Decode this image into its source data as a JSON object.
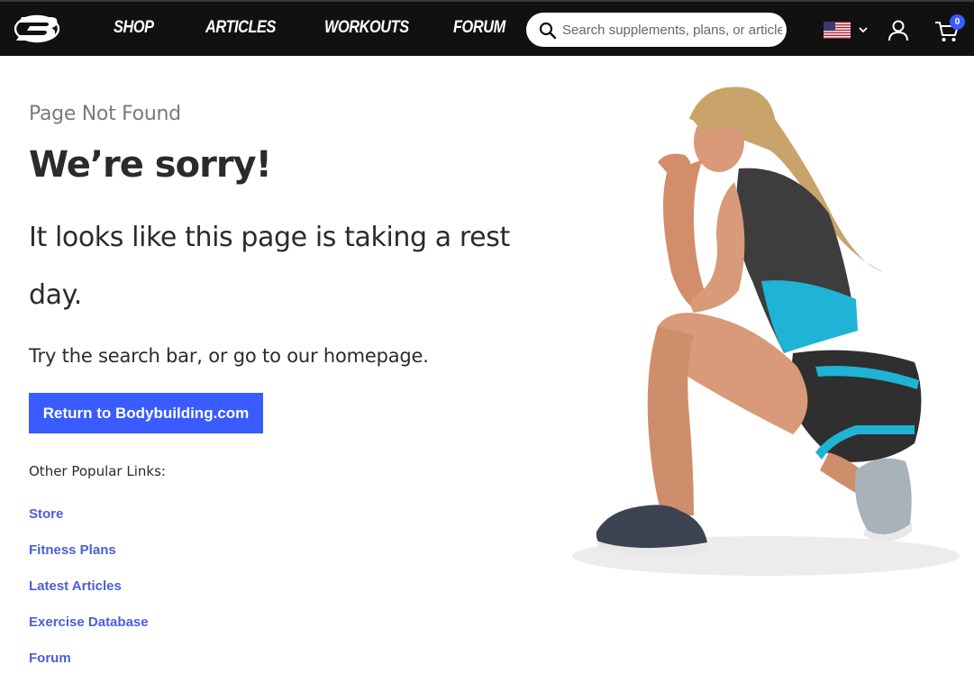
{
  "header": {
    "logo_name": "bodybuilding-b-logo",
    "nav": [
      {
        "label": "SHOP"
      },
      {
        "label": "ARTICLES"
      },
      {
        "label": "WORKOUTS"
      },
      {
        "label": "FORUM"
      }
    ],
    "search": {
      "placeholder": "Search supplements, plans, or articles",
      "value": ""
    },
    "cart_count": "0",
    "colors": {
      "background": "#111111",
      "accent": "#3a5bff"
    }
  },
  "main": {
    "eyebrow": "Page Not Found",
    "headline": "We’re sorry!",
    "subhead": "It looks like this page is taking a rest day.",
    "hint": "Try the search bar, or go to our homepage.",
    "button_label": "Return to Bodybuilding.com",
    "links_label": "Other Popular Links:",
    "links": [
      {
        "label": "Store"
      },
      {
        "label": "Fitness Plans"
      },
      {
        "label": "Latest Articles"
      },
      {
        "label": "Exercise Database"
      },
      {
        "label": "Forum"
      }
    ],
    "link_color": "#4a5fd6"
  }
}
